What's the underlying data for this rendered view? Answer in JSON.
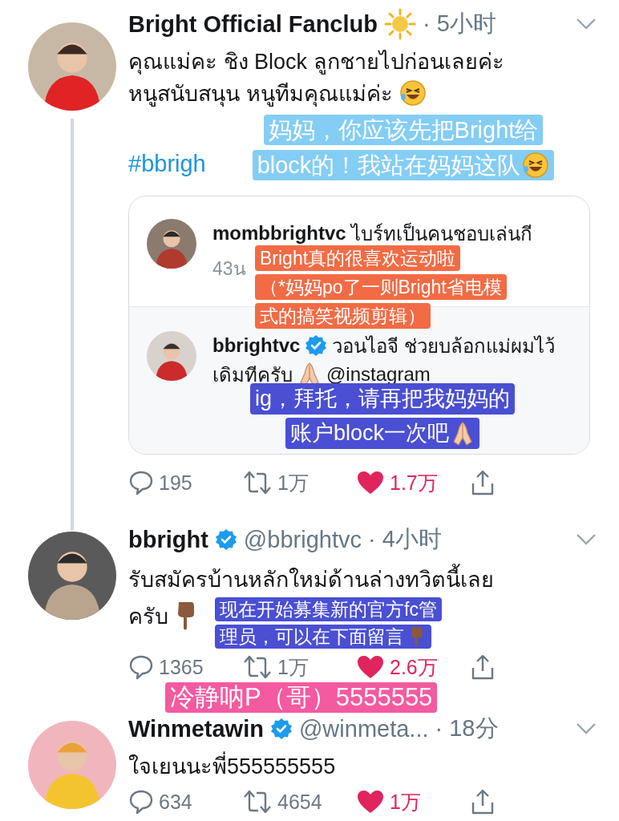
{
  "tweets": [
    {
      "name": "Bright Official Fanclub",
      "name_emoji": {
        "kind": "sun"
      },
      "verified": false,
      "time": "· 5小时",
      "thread_line": true,
      "text": [
        {
          "text": "คุณแม่คะ ชิง Block ลูกชายไปก่อนเลยค่ะ"
        },
        {
          "text": "หนูสนับสนุน หนูทีมคุณแม่ค่ะ",
          "emoji": {
            "kind": "laugh"
          }
        }
      ],
      "hashtag": "#bbrigh",
      "quote": {
        "rows": [
          {
            "name": "mombbrightvc",
            "verified": false,
            "text": "ไบร์ทเป็นคนชอบเล่นกี",
            "time": "43น"
          },
          {
            "name": "bbrightvc",
            "verified": true,
            "text": "วอนไอจี ช่วยบล้อกแม่ผมไว้",
            "text2": "เดิมทีครับ",
            "text2_emoji": {
              "kind": "pray"
            },
            "mention": "@instagram"
          }
        ]
      },
      "actions": {
        "replies": "195",
        "retweets": "1万",
        "likes": "1.7万",
        "liked": true
      },
      "captions": [
        {
          "color": "#84cdf4",
          "lines": [
            {
              "text": "妈妈，你应该先把Bright给"
            },
            {
              "text": "block的！我站在妈妈这队",
              "emoji": {
                "kind": "laugh"
              }
            }
          ]
        },
        {
          "color": "#f26b45",
          "lines": [
            {
              "text": "Bright真的很喜欢运动啦"
            },
            {
              "text": "（*妈妈po了一则Bright省电模"
            },
            {
              "text": "式的搞笑视频剪辑）"
            }
          ]
        },
        {
          "color": "#4a4fd3",
          "lines": [
            {
              "text": "ig，拜托，请再把我妈妈的"
            },
            {
              "text": "账户block一次吧",
              "emoji": {
                "kind": "pray"
              }
            }
          ]
        }
      ]
    },
    {
      "name": "bbright",
      "verified": true,
      "handle": "@bbrightvc",
      "time": "· 4小时",
      "thread_line": false,
      "text": [
        {
          "text": "รับสมัครบ้านหลักใหม่ด้านล่างทวิตนี้เลย"
        },
        {
          "text": "ครับ",
          "emoji": {
            "kind": "point-down"
          }
        }
      ],
      "actions": {
        "replies": "1365",
        "retweets": "1万",
        "likes": "2.6万",
        "liked": true
      },
      "captions": [
        {
          "color": "#4a4fd3",
          "lines": [
            {
              "text": "现在开始募集新的官方fc管"
            },
            {
              "text": "理员，可以在下面留言",
              "emoji": {
                "kind": "point-down"
              }
            }
          ]
        },
        {
          "color": "#f45aa0",
          "lines": [
            {
              "text": "冷静呐P（哥）5555555"
            }
          ]
        }
      ]
    },
    {
      "name": "Winmetawin",
      "verified": true,
      "handle": "@winmeta...",
      "time": "· 18分",
      "thread_line": false,
      "text": [
        {
          "text": "ใจเยนนะพี่555555555"
        }
      ],
      "actions": {
        "replies": "634",
        "retweets": "4654",
        "likes": "1万",
        "liked": true
      }
    }
  ]
}
